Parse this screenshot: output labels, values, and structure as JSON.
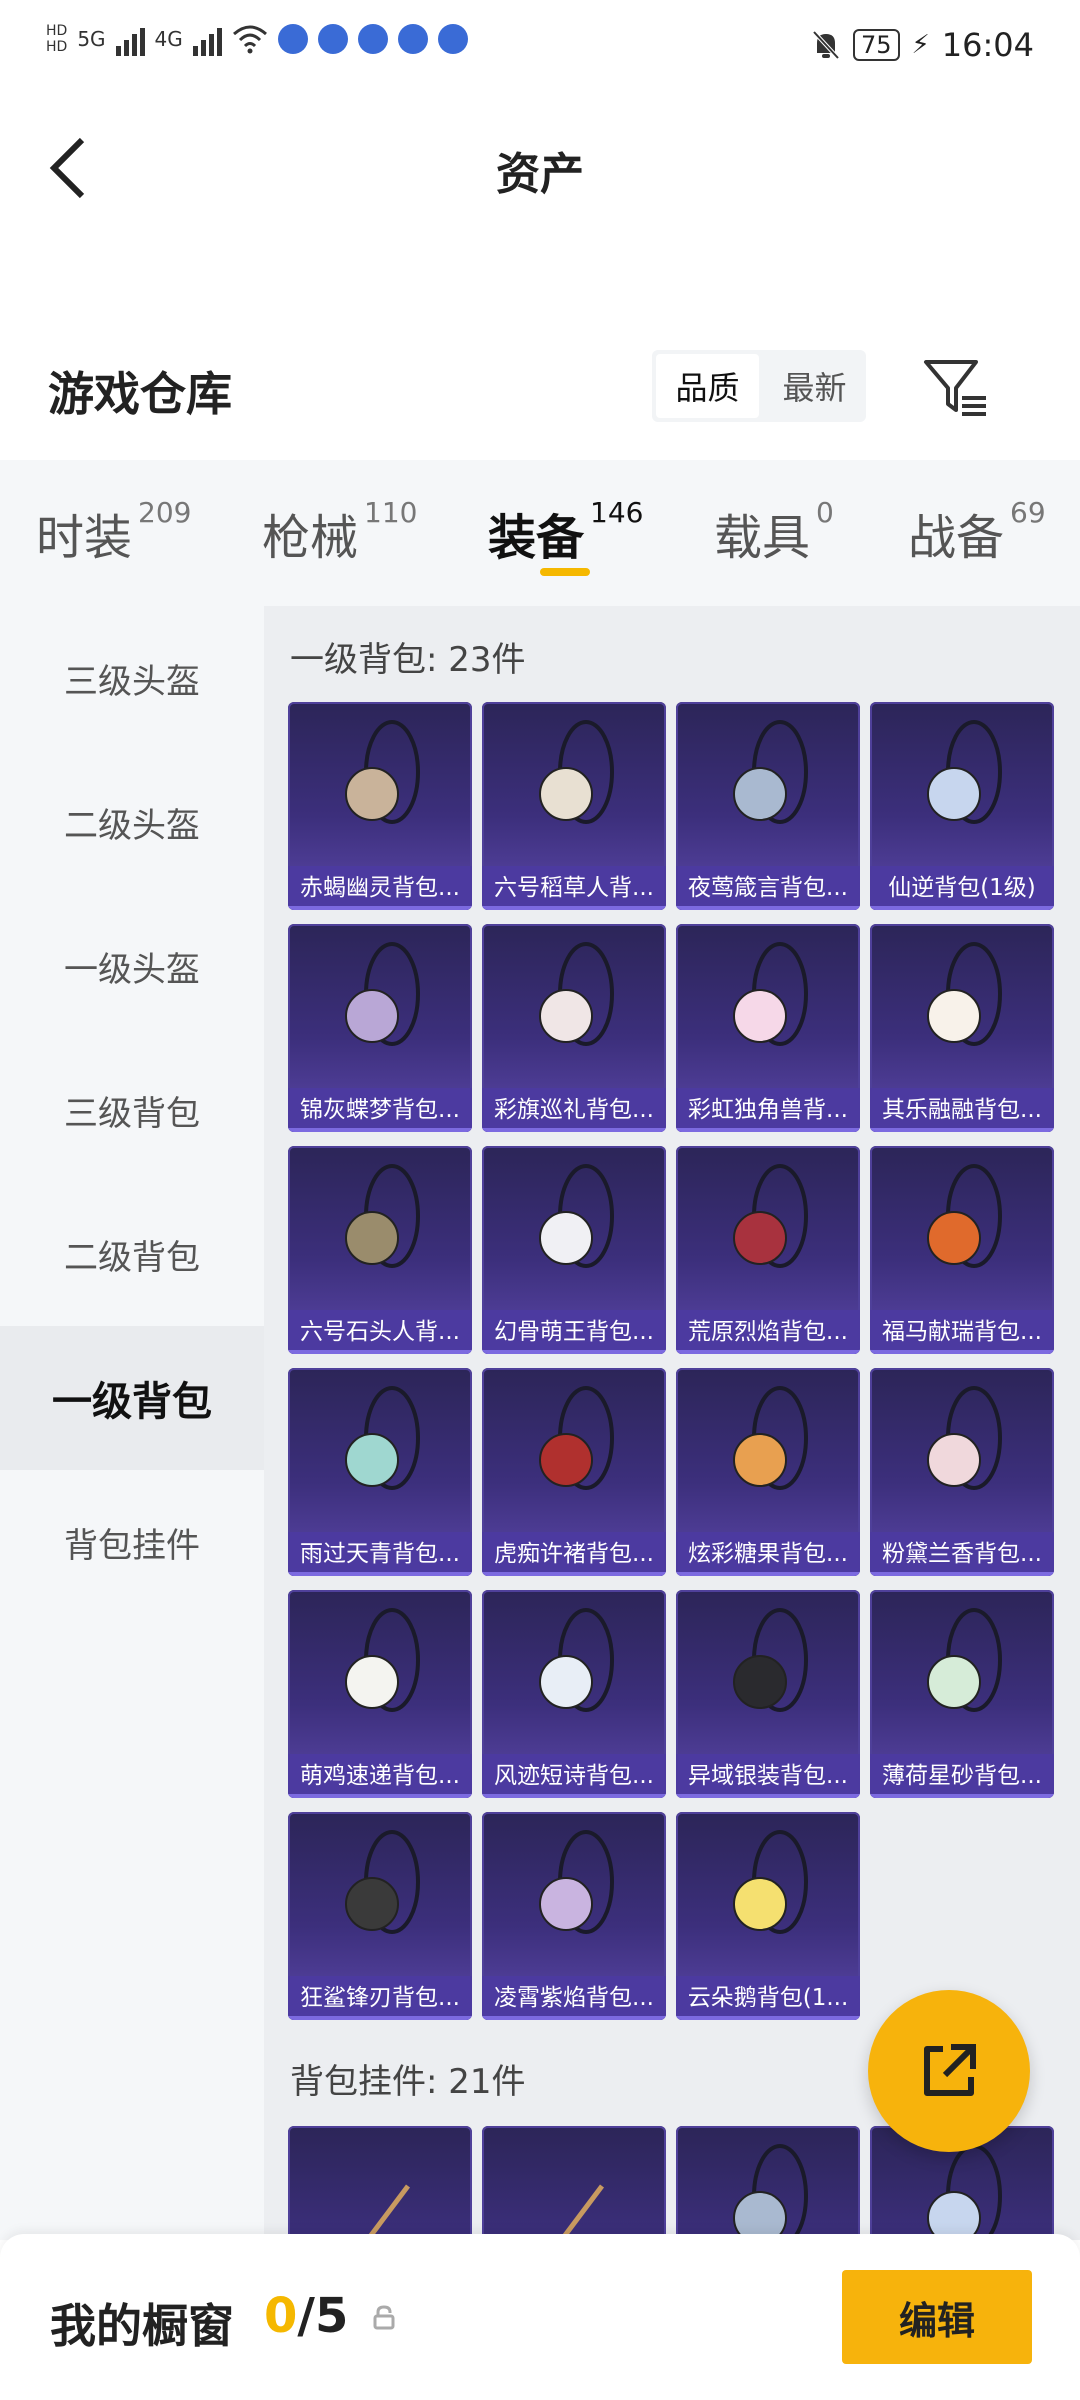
{
  "status_bar": {
    "network": [
      "5G",
      "4G"
    ],
    "battery": "75",
    "time": "16:04"
  },
  "header": {
    "title": "资产"
  },
  "warehouse": {
    "title": "游戏仓库",
    "sort_options": [
      "品质",
      "最新"
    ],
    "active_sort": "品质"
  },
  "tabs": [
    {
      "label": "时装",
      "count": "209"
    },
    {
      "label": "枪械",
      "count": "110"
    },
    {
      "label": "装备",
      "count": "146",
      "active": true
    },
    {
      "label": "载具",
      "count": "0"
    },
    {
      "label": "战备",
      "count": "69"
    }
  ],
  "sidebar": {
    "items": [
      "三级头盔",
      "二级头盔",
      "一级头盔",
      "三级背包",
      "二级背包",
      "一级背包",
      "背包挂件"
    ],
    "active_index": 5
  },
  "sections": [
    {
      "title": "一级背包: 23件",
      "items": [
        "赤蝎幽灵背包...",
        "六号稻草人背...",
        "夜莺箴言背包...",
        "仙逆背包(1级)",
        "锦灰蝶梦背包...",
        "彩旗巡礼背包...",
        "彩虹独角兽背...",
        "其乐融融背包...",
        "六号石头人背...",
        "幻骨萌王背包...",
        "荒原烈焰背包...",
        "福马献瑞背包...",
        "雨过天青背包...",
        "虎痴许褚背包...",
        "炫彩糖果背包...",
        "粉黛兰香背包...",
        "萌鸡速递背包...",
        "风迹短诗背包...",
        "异域银装背包...",
        "薄荷星砂背包...",
        "狂鲨锋刃背包...",
        "凌霄紫焰背包...",
        "云朵鹅背包(1..."
      ]
    },
    {
      "title": "背包挂件: 21件",
      "items": [
        "",
        "",
        "",
        ""
      ]
    }
  ],
  "bottom": {
    "showcase_label": "我的橱窗",
    "current": "0",
    "separator": "/",
    "max": "5",
    "edit_label": "编辑"
  },
  "colors": {
    "accent": "#f7b30c",
    "card_bg": "#3c2f7c",
    "card_label": "#4c3aa0"
  },
  "icons": [
    "back-arrow-icon",
    "filter-icon",
    "external-link-icon",
    "lock-icon",
    "wifi-icon",
    "signal-icon"
  ]
}
